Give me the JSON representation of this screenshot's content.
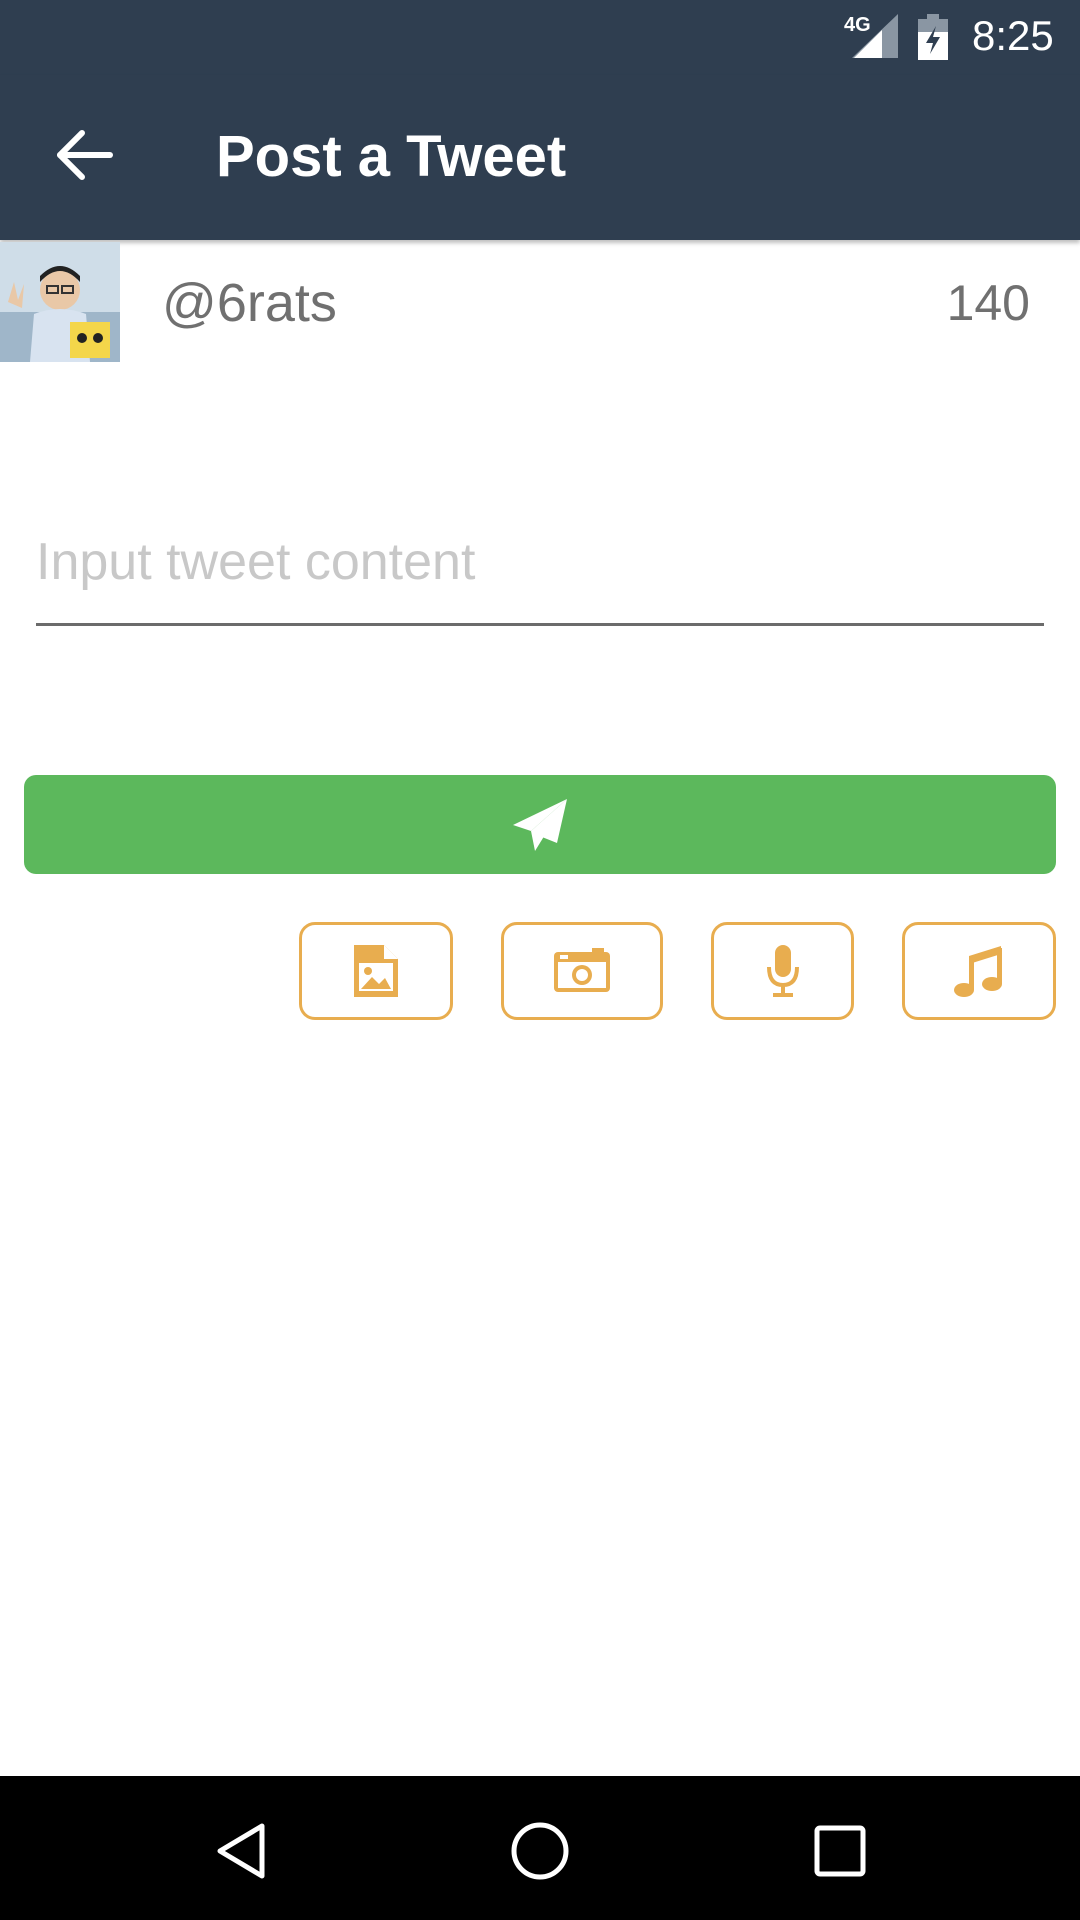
{
  "status_bar": {
    "network": "4G",
    "time": "8:25"
  },
  "toolbar": {
    "title": "Post a Tweet",
    "back_icon": "arrow-left-icon"
  },
  "user": {
    "handle": "@6rats",
    "char_count": "140"
  },
  "compose": {
    "placeholder": "Input tweet content",
    "value": ""
  },
  "send_button": {
    "icon": "paper-plane-icon",
    "color": "#5cb85c"
  },
  "media_buttons": [
    {
      "icon": "image-file-icon"
    },
    {
      "icon": "camera-icon"
    },
    {
      "icon": "microphone-icon"
    },
    {
      "icon": "music-note-icon"
    }
  ],
  "colors": {
    "primary_dark": "#2f3e50",
    "accent_orange": "#e8ad4f",
    "send_green": "#5cb85c",
    "muted_text": "#707070"
  }
}
